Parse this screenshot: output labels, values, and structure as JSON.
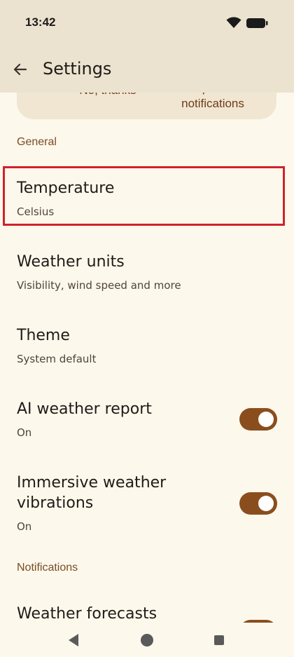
{
  "status": {
    "time": "13:42"
  },
  "app_bar": {
    "title": "Settings"
  },
  "banner": {
    "no_label": "No, thanks",
    "update_line1": "Update",
    "update_line2": "notifications"
  },
  "sections": {
    "general": "General",
    "notifications": "Notifications"
  },
  "settings": [
    {
      "title": "Temperature",
      "subtitle": "Celsius"
    },
    {
      "title": "Weather units",
      "subtitle": "Visibility, wind speed and more"
    },
    {
      "title": "Theme",
      "subtitle": "System default"
    },
    {
      "title": "AI weather report",
      "subtitle": "On",
      "toggle": true
    },
    {
      "title_line1": "Immersive weather",
      "title_line2": "vibrations",
      "subtitle": "On",
      "toggle": true
    },
    {
      "title": "Weather forecasts",
      "toggle": true
    }
  ],
  "colors": {
    "accent": "#8a4e1e",
    "section": "#7a4c24",
    "highlight": "#d0222c",
    "background": "#fdf8ec"
  }
}
